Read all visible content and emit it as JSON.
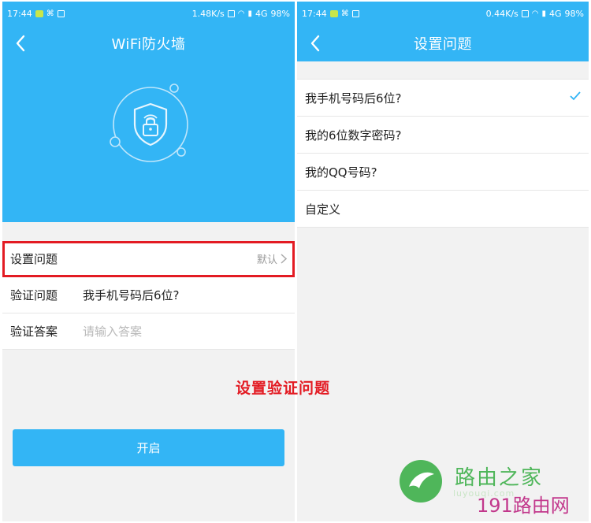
{
  "left": {
    "status": {
      "time": "17:44",
      "speed": "1.48K/s",
      "network": "4G",
      "battery": "98%"
    },
    "title": "WiFi防火墙",
    "rows": [
      {
        "label": "设置问题",
        "value": "默认"
      },
      {
        "label": "验证问题",
        "value": "我手机号码后6位?"
      },
      {
        "label": "验证答案",
        "placeholder": "请输入答案"
      }
    ],
    "button_label": "开启"
  },
  "right": {
    "status": {
      "time": "17:44",
      "speed": "0.44K/s",
      "network": "4G",
      "battery": "98%"
    },
    "title": "设置问题",
    "options": [
      {
        "label": "我手机号码后6位?",
        "selected": true
      },
      {
        "label": "我的6位数字密码?",
        "selected": false
      },
      {
        "label": "我的QQ号码?",
        "selected": false
      },
      {
        "label": "自定义",
        "selected": false
      }
    ]
  },
  "annotation": "设置验证问题",
  "watermark": {
    "brand": "路由之家",
    "url": "luyouqi.com",
    "site": "191路由网"
  },
  "colors": {
    "accent": "#33b5f5",
    "highlight": "#e31b23",
    "brand_green": "#4fb65a",
    "site_magenta": "#c2388c"
  }
}
